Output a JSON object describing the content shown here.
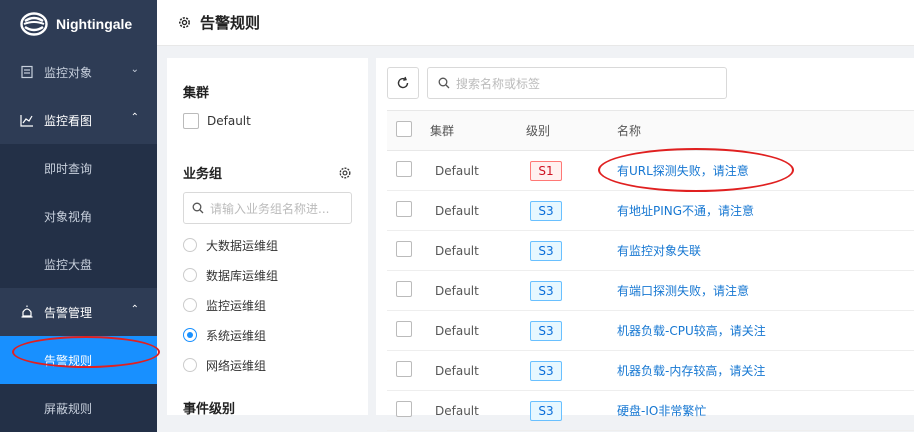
{
  "app": {
    "name": "Nightingale"
  },
  "sidebar": {
    "groups": [
      {
        "label": "监控对象",
        "expanded": false
      },
      {
        "label": "监控看图",
        "expanded": true,
        "items": [
          "即时查询",
          "对象视角",
          "监控大盘"
        ]
      },
      {
        "label": "告警管理",
        "expanded": true,
        "items": [
          "告警规则",
          "屏蔽规则"
        ],
        "active": "告警规则"
      }
    ]
  },
  "header": {
    "title": "告警规则"
  },
  "filters": {
    "cluster_title": "集群",
    "cluster_option": "Default",
    "business_group_title": "业务组",
    "business_group_search_placeholder": "请输入业务组名称进...",
    "business_groups": [
      "大数据运维组",
      "数据库运维组",
      "监控运维组",
      "系统运维组",
      "网络运维组"
    ],
    "selected_group": "系统运维组",
    "event_level_title": "事件级别"
  },
  "main": {
    "search_placeholder": "搜索名称或标签",
    "columns": [
      "集群",
      "级别",
      "名称"
    ],
    "rows": [
      {
        "cluster": "Default",
        "level": "S1",
        "name": "有URL探测失败，请注意"
      },
      {
        "cluster": "Default",
        "level": "S3",
        "name": "有地址PING不通，请注意"
      },
      {
        "cluster": "Default",
        "level": "S3",
        "name": "有监控对象失联"
      },
      {
        "cluster": "Default",
        "level": "S3",
        "name": "有端口探测失败，请注意"
      },
      {
        "cluster": "Default",
        "level": "S3",
        "name": "机器负载-CPU较高，请关注"
      },
      {
        "cluster": "Default",
        "level": "S3",
        "name": "机器负载-内存较高，请关注"
      },
      {
        "cluster": "Default",
        "level": "S3",
        "name": "硬盘-IO非常繁忙"
      }
    ]
  },
  "colors": {
    "sidebar": "#2e3c55",
    "active": "#1890ff",
    "link": "#1677d2",
    "annotation": "#e02020"
  }
}
